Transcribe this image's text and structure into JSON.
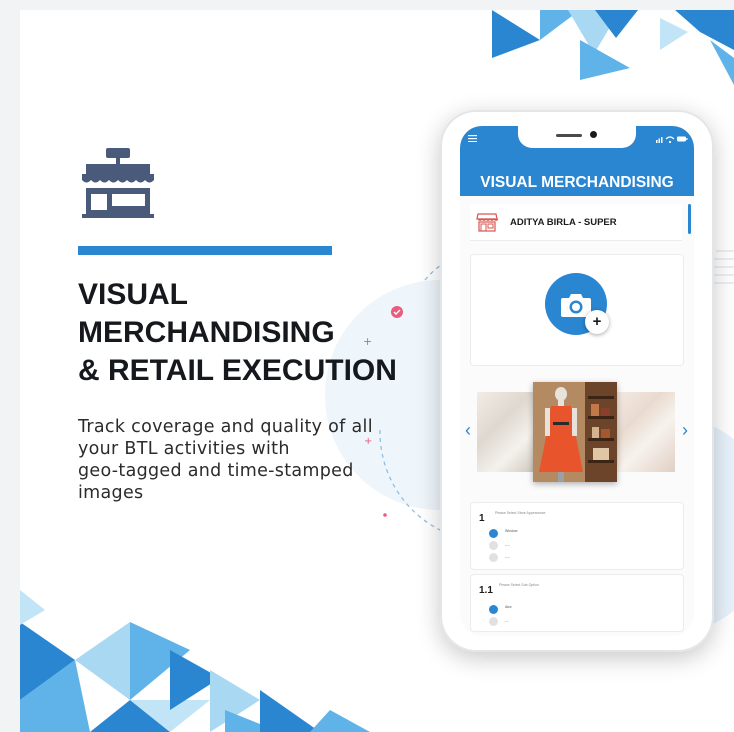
{
  "headline": {
    "lines": [
      "VISUAL",
      "MERCHANDISING",
      "& RETAIL EXECUTION"
    ]
  },
  "description": {
    "lines": [
      "Track coverage and quality of all",
      "your BTL activities with",
      "geo-tagged and time-stamped",
      "images"
    ]
  },
  "phone": {
    "app_title": "VISUAL MERCHANDISING",
    "store_name": "ADITYA BIRLA - SUPER",
    "camera_plus": "+",
    "carousel": {
      "prev": "‹",
      "next": "›"
    },
    "questions": [
      {
        "number": "1",
        "text": "Please Select Store Appearance",
        "options": [
          {
            "label": "Window",
            "selected": true
          },
          {
            "label": "----",
            "selected": false
          },
          {
            "label": "----",
            "selected": false
          }
        ]
      },
      {
        "number": "1.1",
        "text": "Please Select Sub Option",
        "options": [
          {
            "label": "Atra",
            "selected": true
          },
          {
            "label": "---",
            "selected": false
          }
        ]
      }
    ]
  },
  "icons": {
    "store": "storefront-icon",
    "menu": "hamburger-menu-icon",
    "status": "signal-wifi-battery-icons",
    "camera": "camera-icon",
    "plus": "plus-icon"
  },
  "colors": {
    "brand_blue": "#2a86d1",
    "icon_slate": "#4a5a7a",
    "headline_text": "#15181c"
  }
}
